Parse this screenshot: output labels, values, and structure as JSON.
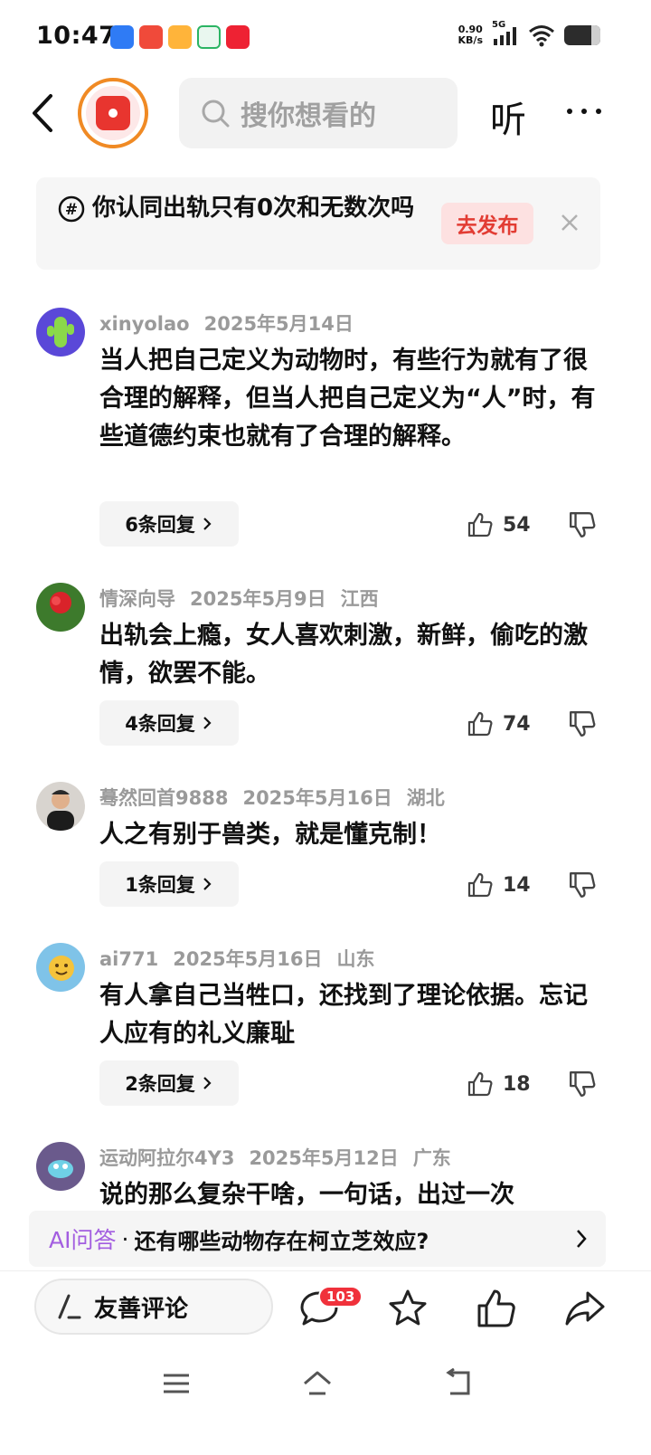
{
  "status_bar": {
    "time": "10:47",
    "net_speed_value": "0.90",
    "net_speed_unit": "KB/s",
    "network": "5G",
    "battery_level": 0.7
  },
  "header": {
    "search_placeholder": "搜你想看的",
    "listen_label": "听"
  },
  "topic": {
    "text": "你认同出轨只有0次和无数次吗",
    "publish_label": "去发布"
  },
  "comments": [
    {
      "user": "xinyolao",
      "date": "2025年5月14日",
      "location": "",
      "text": "当人把自己定义为动物时，有些行为就有了很合理的解释，但当人把自己定义为“人”时，有些道德约束也就有了合理的解释。",
      "replies": "6条回复",
      "likes": "54"
    },
    {
      "user": "情深向导",
      "date": "2025年5月9日",
      "location": "江西",
      "text": "出轨会上瘾，女人喜欢刺激，新鲜，偷吃的激情，欲罢不能。",
      "replies": "4条回复",
      "likes": "74"
    },
    {
      "user": "蓦然回首9888",
      "date": "2025年5月16日",
      "location": "湖北",
      "text": "人之有别于兽类，就是懂克制！",
      "replies": "1条回复",
      "likes": "14"
    },
    {
      "user": "ai771",
      "date": "2025年5月16日",
      "location": "山东",
      "text": "有人拿自己当牲口，还找到了理论依据。忘记人应有的礼义廉耻",
      "replies": "2条回复",
      "likes": "18"
    },
    {
      "user": "运动阿拉尔4Y3",
      "date": "2025年5月12日",
      "location": "广东",
      "text": "说的那么复杂干啥，一句话，出过一次"
    }
  ],
  "ai_bar": {
    "label": "AI问答",
    "separator": "·",
    "question": "还有哪些动物存在柯立芝效应?"
  },
  "action_bar": {
    "comment_placeholder": "友善评论",
    "comment_count": "103"
  },
  "colors": {
    "accent_red": "#e23c33",
    "ai_purple": "#a35ee0",
    "logo_orange": "#f08a24"
  }
}
